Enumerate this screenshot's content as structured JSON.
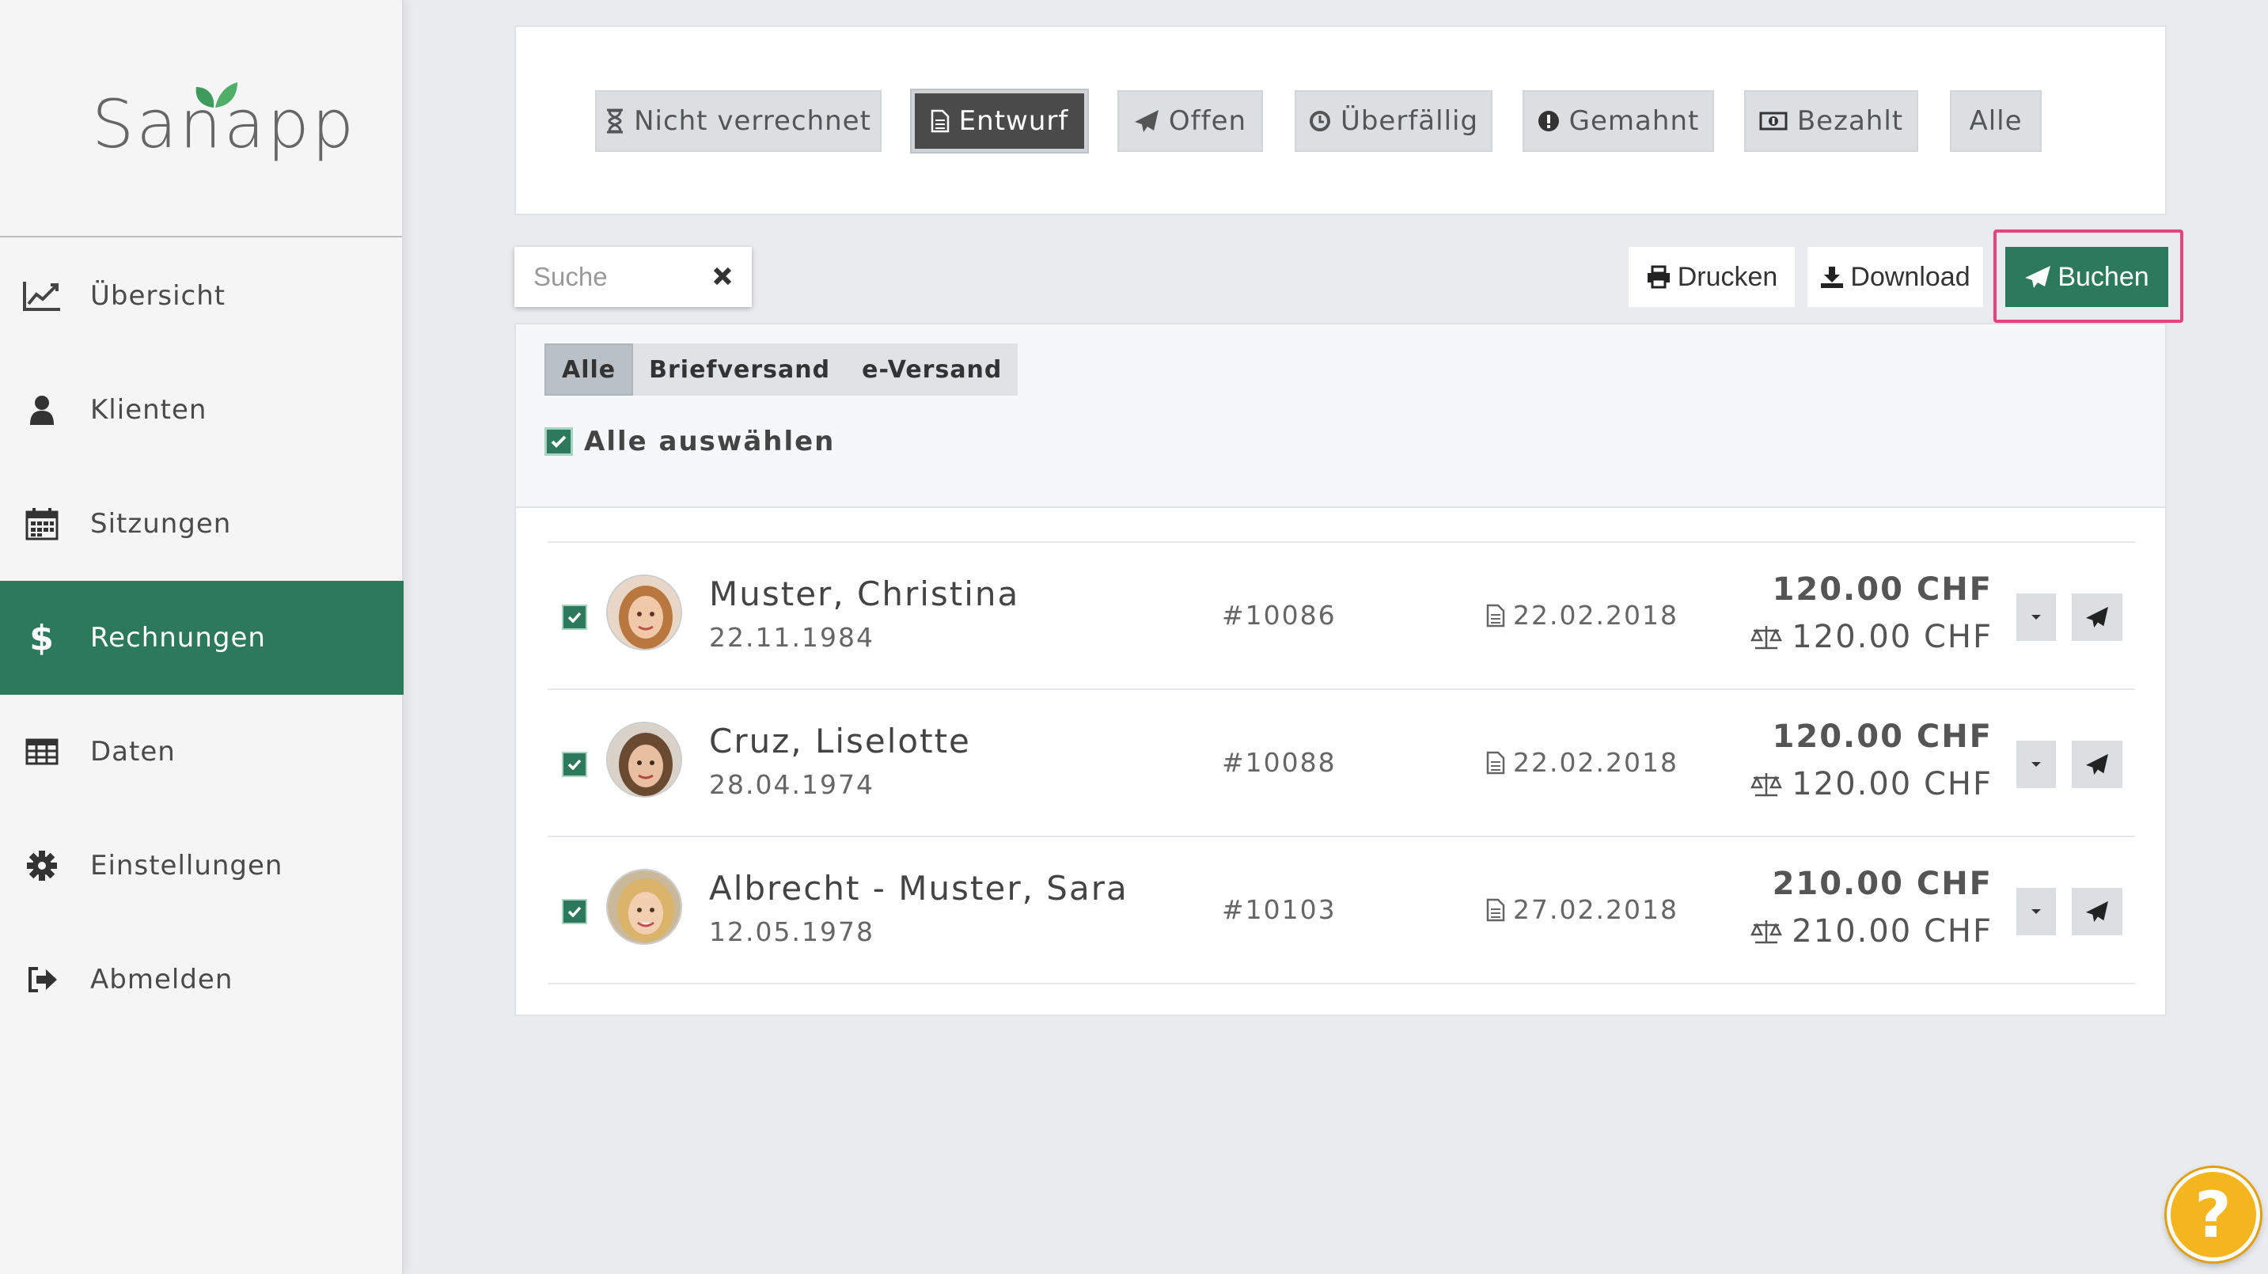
{
  "app": {
    "logo_text": "Sanapp"
  },
  "sidebar": {
    "items": [
      {
        "label": "Übersicht",
        "icon": "chart-line-icon"
      },
      {
        "label": "Klienten",
        "icon": "user-icon"
      },
      {
        "label": "Sitzungen",
        "icon": "calendar-icon"
      },
      {
        "label": "Rechnungen",
        "icon": "dollar-icon",
        "active": true
      },
      {
        "label": "Daten",
        "icon": "table-icon"
      },
      {
        "label": "Einstellungen",
        "icon": "gear-icon"
      },
      {
        "label": "Abmelden",
        "icon": "sign-out-icon"
      }
    ]
  },
  "filters": [
    {
      "label": "Nicht verrechnet",
      "icon": "hourglass-icon"
    },
    {
      "label": "Entwurf",
      "icon": "file-icon",
      "active": true
    },
    {
      "label": "Offen",
      "icon": "paper-plane-icon"
    },
    {
      "label": "Überfällig",
      "icon": "clock-icon"
    },
    {
      "label": "Gemahnt",
      "icon": "exclamation-circle-icon"
    },
    {
      "label": "Bezahlt",
      "icon": "money-icon"
    },
    {
      "label": "Alle",
      "icon": ""
    }
  ],
  "toolbar": {
    "search_placeholder": "Suche",
    "print_label": "Drucken",
    "download_label": "Download",
    "book_label": "Buchen"
  },
  "delivery_tabs": [
    "Alle",
    "Briefversand",
    "e-Versand"
  ],
  "select_all_label": "Alle auswählen",
  "invoices": [
    {
      "name": "Muster, Christina",
      "dob": "22.11.1984",
      "number": "#10086",
      "date": "22.02.2018",
      "amount": "120.00 CHF",
      "balance": "120.00 CHF",
      "checked": true
    },
    {
      "name": "Cruz, Liselotte",
      "dob": "28.04.1974",
      "number": "#10088",
      "date": "22.02.2018",
      "amount": "120.00 CHF",
      "balance": "120.00 CHF",
      "checked": true
    },
    {
      "name": "Albrecht - Muster, Sara",
      "dob": "12.05.1978",
      "number": "#10103",
      "date": "27.02.2018",
      "amount": "210.00 CHF",
      "balance": "210.00 CHF",
      "checked": true
    }
  ],
  "help_label": "?",
  "colors": {
    "accent": "#2c7a5b",
    "highlight": "#e5457f",
    "help": "#f4b51e"
  }
}
